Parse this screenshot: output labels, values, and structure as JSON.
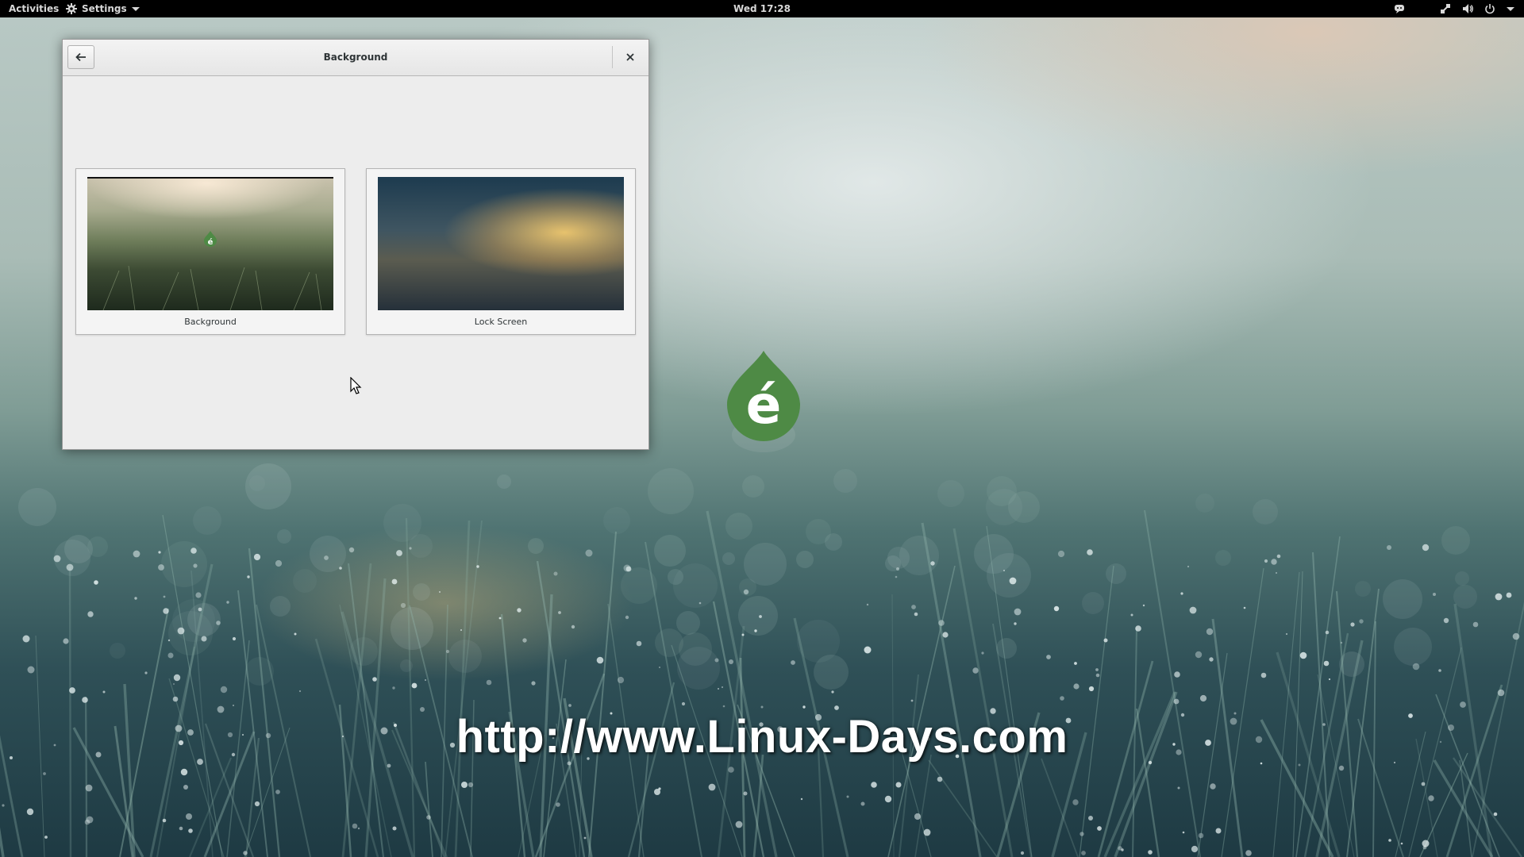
{
  "topbar": {
    "activities_label": "Activities",
    "app_menu_label": "Settings",
    "clock": "Wed 17:28",
    "tray_icons": [
      "chat-icon",
      "network-icon",
      "volume-icon",
      "power-icon",
      "menu-arrow-icon"
    ]
  },
  "window": {
    "title": "Background",
    "back_icon": "back-arrow-icon",
    "close_icon": "close-icon",
    "tiles": [
      {
        "label": "Background"
      },
      {
        "label": "Lock Screen"
      }
    ]
  },
  "desktop": {
    "watermark": "http://www.Linux-Days.com",
    "logo_letter": "é"
  },
  "colors": {
    "topbar_bg": "#000000",
    "window_bg": "#ededed",
    "logo_green": "#4e8a45"
  }
}
